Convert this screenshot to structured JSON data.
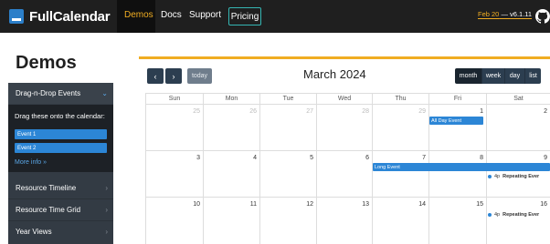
{
  "brand": {
    "name": "FullCalendar"
  },
  "nav": {
    "items": [
      "Demos",
      "Docs",
      "Support"
    ],
    "pricing": "Pricing",
    "version_date": "Feb 20",
    "version_sep": " — ",
    "version": "v6.1.11"
  },
  "sidebar": {
    "title": "Demos",
    "open_item": "Drag-n-Drop Events",
    "drag_title": "Drag these onto the calendar:",
    "external_events": [
      "Event 1",
      "Event 2"
    ],
    "more_info": "More info »",
    "items": [
      "Resource Timeline",
      "Resource Time Grid",
      "Year Views"
    ]
  },
  "calendar": {
    "title": "March 2024",
    "today_label": "today",
    "prev_icon": "‹",
    "next_icon": "›",
    "views": [
      "month",
      "week",
      "day",
      "list"
    ],
    "active_view": "month",
    "weekdays": [
      "Sun",
      "Mon",
      "Tue",
      "Wed",
      "Thu",
      "Fri",
      "Sat"
    ],
    "weeks": [
      [
        "25",
        "26",
        "27",
        "28",
        "29",
        "1",
        "2"
      ],
      [
        "3",
        "4",
        "5",
        "6",
        "7",
        "8",
        "9"
      ],
      [
        "10",
        "11",
        "12",
        "13",
        "14",
        "15",
        "16"
      ]
    ],
    "events": {
      "all_day": "All Day Event",
      "long": "Long Event",
      "repeat_time": "4p",
      "repeat_name": "Repeating Ever"
    }
  },
  "colors": {
    "accent": "#f0ad22",
    "event": "#2c86d6",
    "navbar": "#1f1f1f",
    "sidebar": "#333b44"
  }
}
